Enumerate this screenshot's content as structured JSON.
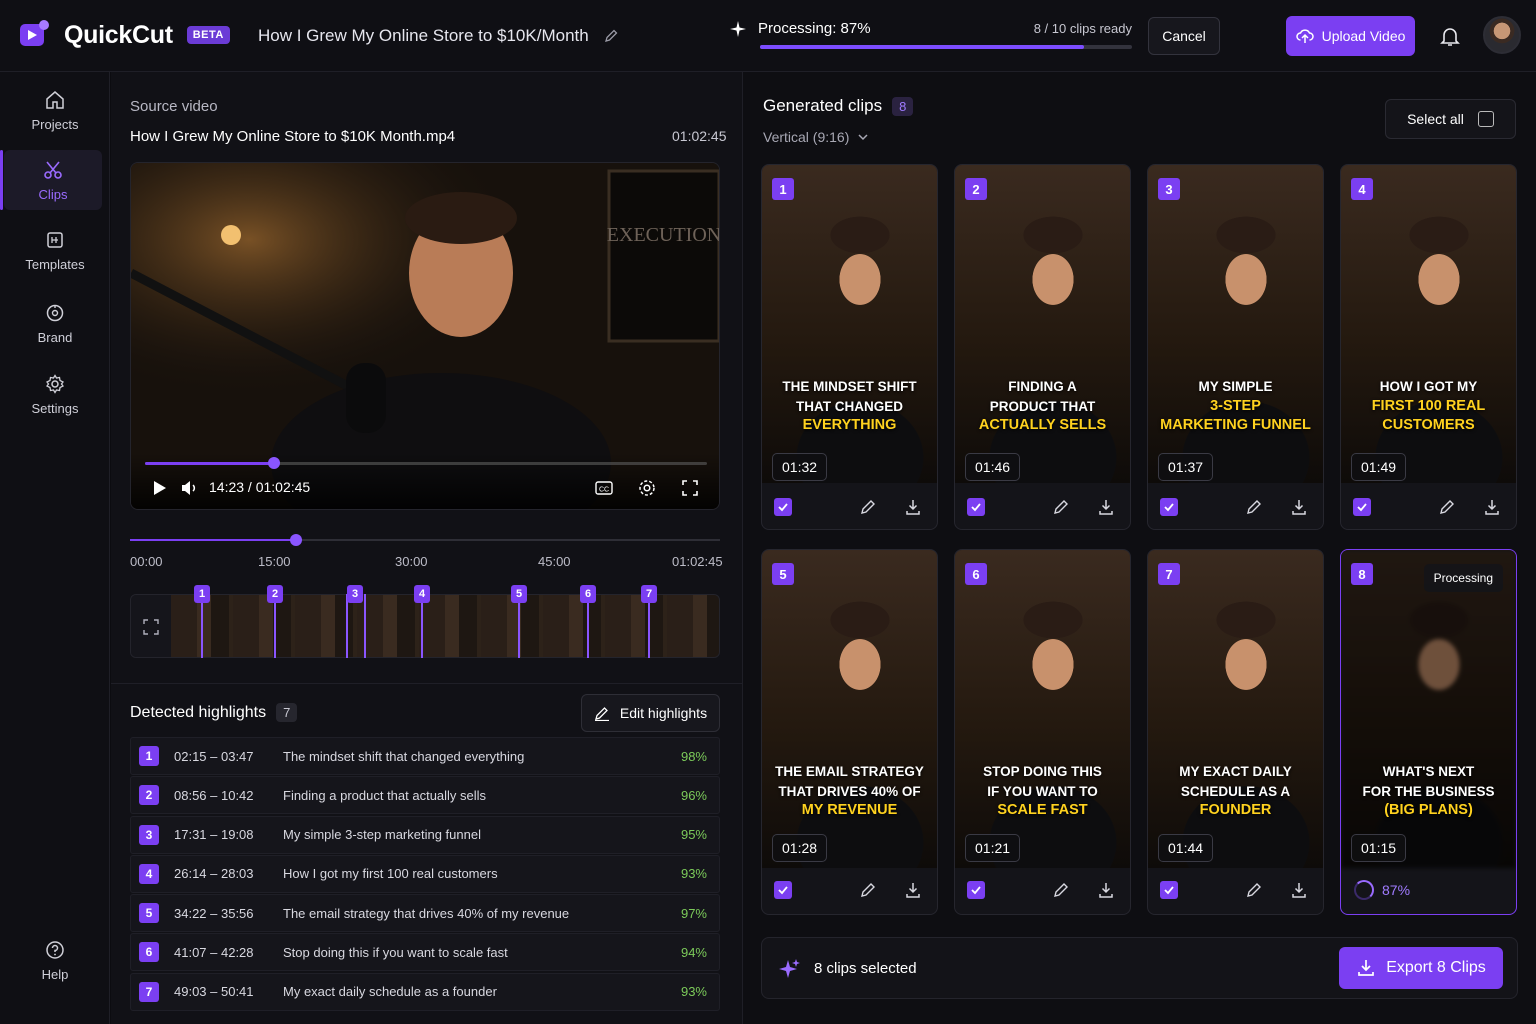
{
  "app": {
    "name": "QuickCut",
    "badge": "BETA"
  },
  "project": {
    "title": "How I Grew My Online Store to $10K/Month"
  },
  "processing": {
    "label": "Processing: 87%",
    "progress": 0.87,
    "ready": "8 / 10 clips ready",
    "cancel": "Cancel"
  },
  "upload": {
    "label": "Upload Video"
  },
  "nav": {
    "projects": "Projects",
    "clips": "Clips",
    "templates": "Templates",
    "brand": "Brand",
    "settings": "Settings",
    "help": "Help"
  },
  "source": {
    "label": "Source video",
    "filename": "How I Grew My Online Store to $10K Month.mp4",
    "duration": "01:02:45",
    "time": "14:23 / 01:02:45",
    "playhead_fraction": 0.23
  },
  "timeline": {
    "ticks": [
      "00:00",
      "15:00",
      "30:00",
      "45:00",
      "01:02:45"
    ],
    "markers": [
      "1",
      "2",
      "3",
      "4",
      "5",
      "6",
      "7"
    ]
  },
  "highlights": {
    "title": "Detected highlights",
    "count": "7",
    "edit_label": "Edit highlights",
    "rows": [
      {
        "num": "1",
        "time": "02:15 – 03:47",
        "text": "The mindset shift that changed everything",
        "pct": "98%"
      },
      {
        "num": "2",
        "time": "08:56 – 10:42",
        "text": "Finding a product that actually sells",
        "pct": "96%"
      },
      {
        "num": "3",
        "time": "17:31 – 19:08",
        "text": "My simple 3-step marketing funnel",
        "pct": "95%"
      },
      {
        "num": "4",
        "time": "26:14 – 28:03",
        "text": "How I got my first 100 real customers",
        "pct": "93%"
      },
      {
        "num": "5",
        "time": "34:22 – 35:56",
        "text": "The email strategy that drives 40% of my revenue",
        "pct": "97%"
      },
      {
        "num": "6",
        "time": "41:07 – 42:28",
        "text": "Stop doing this if you want to scale fast",
        "pct": "94%"
      },
      {
        "num": "7",
        "time": "49:03 – 50:41",
        "text": "My exact daily schedule as a founder",
        "pct": "93%"
      }
    ]
  },
  "clips": {
    "title": "Generated clips",
    "count": "8",
    "ratio": "Vertical (9:16)",
    "select_all": "Select all",
    "items": [
      {
        "num": "1",
        "l1": "THE MINDSET SHIFT",
        "l2": "THAT CHANGED",
        "l3": "EVERYTHING",
        "dur": "01:32"
      },
      {
        "num": "2",
        "l1": "FINDING A",
        "l2": "PRODUCT THAT",
        "l3": "ACTUALLY SELLS",
        "dur": "01:46"
      },
      {
        "num": "3",
        "l1": "MY SIMPLE",
        "l2": "3-STEP",
        "l3": "MARKETING FUNNEL",
        "dur": "01:37"
      },
      {
        "num": "4",
        "l1": "HOW I GOT MY",
        "l2": "FIRST 100 REAL",
        "l3": "CUSTOMERS",
        "dur": "01:49"
      },
      {
        "num": "5",
        "l1": "THE EMAIL STRATEGY",
        "l2": "THAT DRIVES 40% OF",
        "l3": "MY REVENUE",
        "dur": "01:28"
      },
      {
        "num": "6",
        "l1": "STOP DOING THIS",
        "l2": "IF YOU WANT TO",
        "l3": "SCALE FAST",
        "dur": "01:21"
      },
      {
        "num": "7",
        "l1": "MY EXACT DAILY",
        "l2": "SCHEDULE AS A",
        "l3": "FOUNDER",
        "dur": "01:44"
      },
      {
        "num": "8",
        "l1": "WHAT'S NEXT",
        "l2": "FOR THE BUSINESS",
        "l3": "(BIG PLANS)",
        "dur": "01:15",
        "status": "Processing",
        "pct": "87%"
      }
    ]
  },
  "footer": {
    "selected": "8 clips selected",
    "export": "Export 8 Clips"
  },
  "colors": {
    "accent": "#7b3ff2",
    "highlight_text": "#ffd21f",
    "score": "#7ccb5a"
  }
}
